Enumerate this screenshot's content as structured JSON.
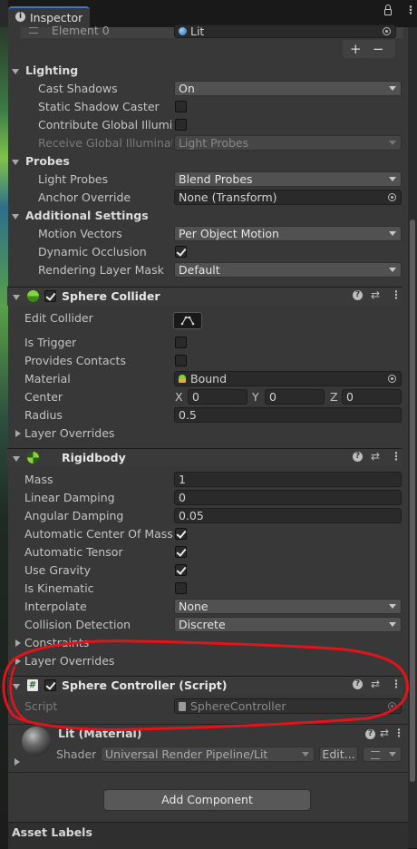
{
  "tab": {
    "title": "Inspector"
  },
  "element0": {
    "label": "Element 0",
    "value": "Lit"
  },
  "list_buttons": {
    "add": "+",
    "remove": "−"
  },
  "lighting": {
    "title": "Lighting",
    "cast_shadows": {
      "label": "Cast Shadows",
      "value": "On"
    },
    "static_shadow_caster": {
      "label": "Static Shadow Caster",
      "checked": false
    },
    "contribute_gi": {
      "label": "Contribute Global Illuminat",
      "checked": false
    },
    "receive_gi": {
      "label": "Receive Global Illuminatior",
      "value": "Light Probes"
    }
  },
  "probes": {
    "title": "Probes",
    "light_probes": {
      "label": "Light Probes",
      "value": "Blend Probes"
    },
    "anchor_override": {
      "label": "Anchor Override",
      "value": "None (Transform)"
    }
  },
  "additional": {
    "title": "Additional Settings",
    "motion_vectors": {
      "label": "Motion Vectors",
      "value": "Per Object Motion"
    },
    "dynamic_occlusion": {
      "label": "Dynamic Occlusion",
      "checked": true
    },
    "rendering_layer_mask": {
      "label": "Rendering Layer Mask",
      "value": "Default"
    }
  },
  "sphere_collider": {
    "title": "Sphere Collider",
    "edit_collider": "Edit Collider",
    "is_trigger": "Is Trigger",
    "provides_contacts": "Provides Contacts",
    "material": {
      "label": "Material",
      "value": "Bound"
    },
    "center": {
      "label": "Center",
      "x_label": "X",
      "y_label": "Y",
      "z_label": "Z",
      "x": "0",
      "y": "0",
      "z": "0"
    },
    "radius": {
      "label": "Radius",
      "value": "0.5"
    },
    "layer_overrides": "Layer Overrides"
  },
  "rigidbody": {
    "title": "Rigidbody",
    "mass": {
      "label": "Mass",
      "value": "1"
    },
    "linear_damping": {
      "label": "Linear Damping",
      "value": "0"
    },
    "angular_damping": {
      "label": "Angular Damping",
      "value": "0.05"
    },
    "auto_center": {
      "label": "Automatic Center Of Mass",
      "checked": true
    },
    "auto_tensor": {
      "label": "Automatic Tensor",
      "checked": true
    },
    "use_gravity": {
      "label": "Use Gravity",
      "checked": true
    },
    "is_kinematic": {
      "label": "Is Kinematic",
      "checked": false
    },
    "interpolate": {
      "label": "Interpolate",
      "value": "None"
    },
    "collision_detection": {
      "label": "Collision Detection",
      "value": "Discrete"
    },
    "constraints": "Constraints",
    "layer_overrides": "Layer Overrides"
  },
  "sphere_controller": {
    "title": "Sphere Controller (Script)",
    "script_label": "Script",
    "script_value": "SphereController"
  },
  "material": {
    "title": "Lit (Material)",
    "shader_label": "Shader",
    "shader_value": "Universal Render Pipeline/Lit",
    "edit_label": "Edit..."
  },
  "add_component": "Add Component",
  "asset_labels": "Asset Labels",
  "colors": {
    "annotation_red": "#e0141a",
    "accent_green": "#7fd43a",
    "panel": "#383838"
  }
}
